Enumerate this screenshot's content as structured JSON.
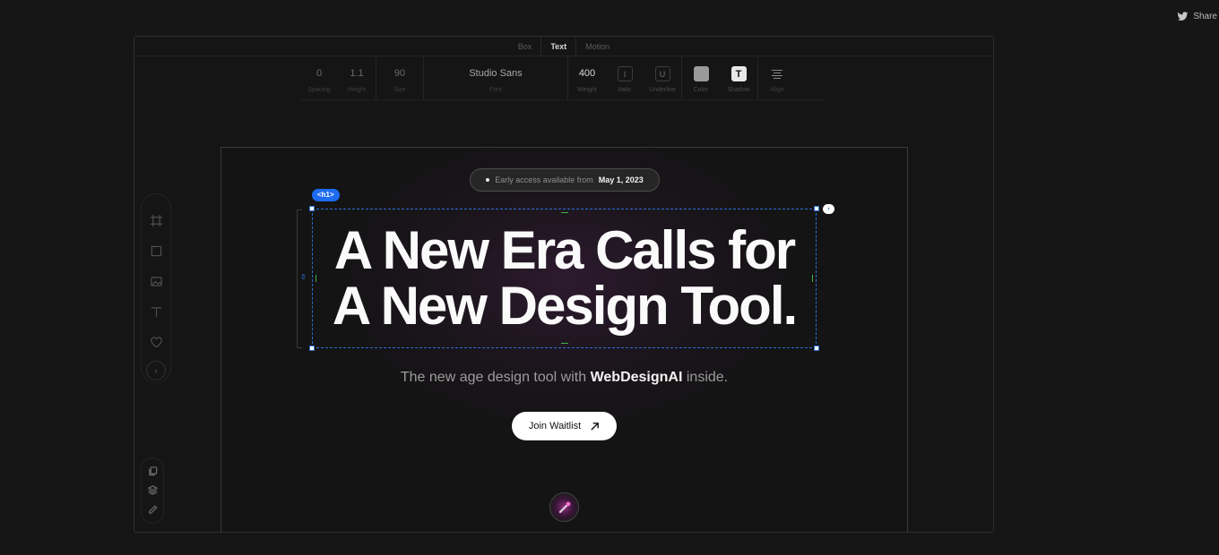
{
  "share": {
    "label": "Share"
  },
  "tabs": [
    {
      "label": "Box"
    },
    {
      "label": "Text"
    },
    {
      "label": "Motion"
    }
  ],
  "toolbar": {
    "spacing": {
      "value": "0",
      "label": "Spacing"
    },
    "height": {
      "value": "1.1",
      "label": "Height"
    },
    "size": {
      "value": "90",
      "label": "Size"
    },
    "font": {
      "value": "Studio Sans",
      "label": "Font"
    },
    "weight": {
      "value": "400",
      "label": "Weight"
    },
    "italic": {
      "glyph": "I",
      "label": "Italic"
    },
    "underline": {
      "glyph": "U",
      "label": "Underline"
    },
    "color": {
      "label": "Color"
    },
    "shadow": {
      "glyph": "T",
      "label": "Shadow"
    },
    "align": {
      "label": "Align"
    }
  },
  "canvas": {
    "pill": {
      "prefix": "Early access available from",
      "date": "May 1, 2023"
    },
    "tag": "<h1>",
    "headline": {
      "line1": "A New Era Calls for",
      "line2": "A New Design Tool."
    },
    "subtitle": {
      "before": "The new age design tool with",
      "brand": "WebDesignAI",
      "after": "inside."
    },
    "cta": {
      "label": "Join Waitlist"
    }
  },
  "colors": {
    "accent": "#1d6cf2",
    "guide": "#3fb043",
    "background": "#161616"
  }
}
